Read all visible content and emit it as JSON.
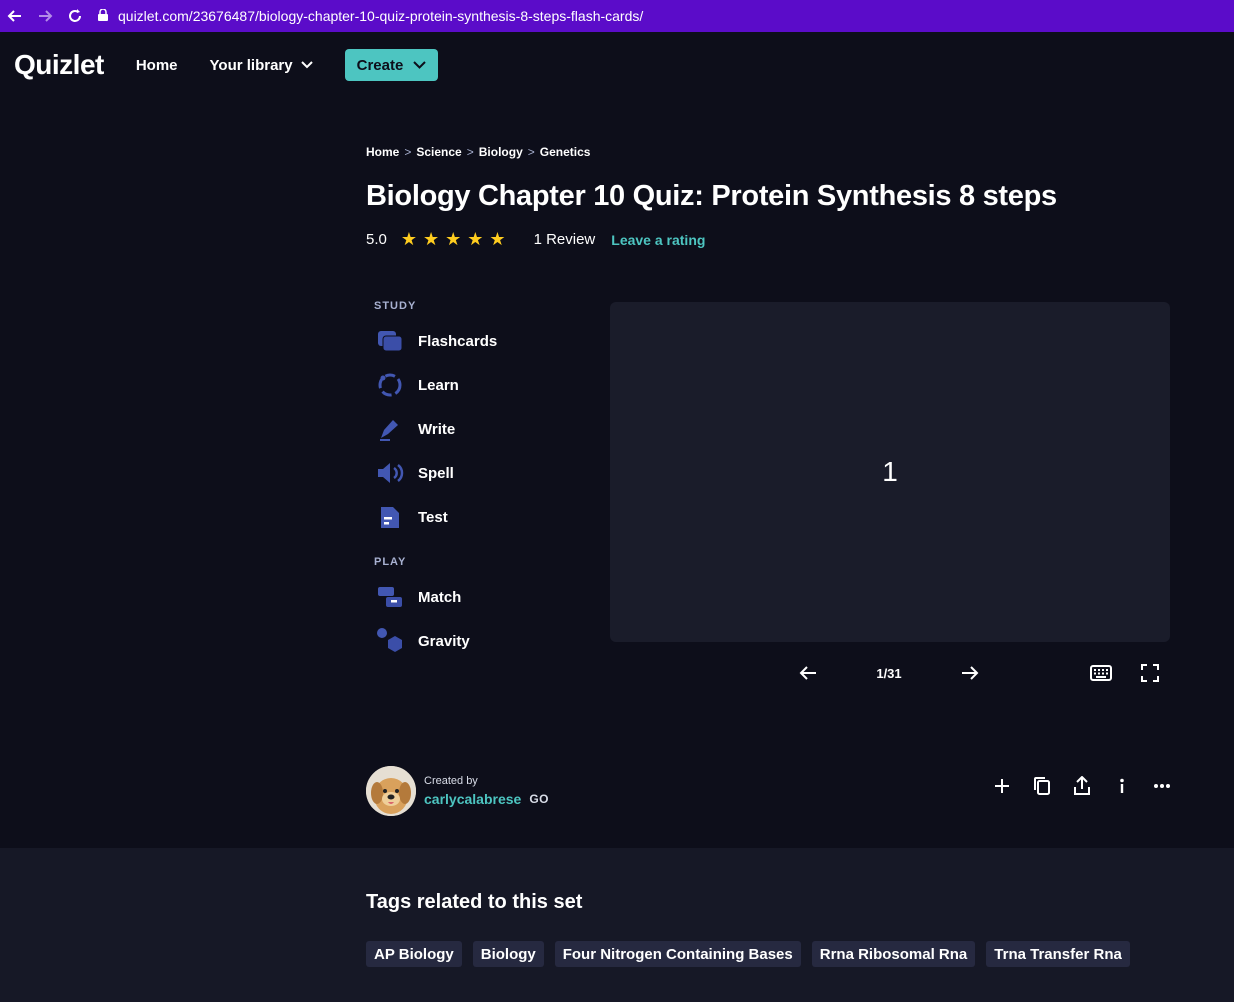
{
  "browser": {
    "url": "quizlet.com/23676487/biology-chapter-10-quiz-protein-synthesis-8-steps-flash-cards/"
  },
  "nav": {
    "logo": "Quizlet",
    "home": "Home",
    "library": "Your library",
    "create": "Create"
  },
  "breadcrumb": [
    "Home",
    "Science",
    "Biology",
    "Genetics"
  ],
  "title": "Biology Chapter 10 Quiz: Protein Synthesis 8 steps",
  "rating": {
    "score": "5.0",
    "stars": 5,
    "reviews": "1 Review",
    "leave": "Leave a rating"
  },
  "study": {
    "label": "STUDY",
    "items": [
      "Flashcards",
      "Learn",
      "Write",
      "Spell",
      "Test"
    ]
  },
  "play": {
    "label": "PLAY",
    "items": [
      "Match",
      "Gravity"
    ]
  },
  "card": {
    "text": "1",
    "counter": "1/31"
  },
  "creator": {
    "by": "Created by",
    "name": "carlycalabrese",
    "badge": "GO"
  },
  "tags": {
    "title": "Tags related to this set",
    "items": [
      "AP Biology",
      "Biology",
      "Four Nitrogen Containing Bases",
      "Rrna Ribosomal Rna",
      "Trna Transfer Rna"
    ]
  },
  "colors": {
    "accent": "#4dc5c1",
    "star": "#ffcd1f",
    "icon": "#4257b2",
    "browserbar": "#5b0cc9"
  }
}
